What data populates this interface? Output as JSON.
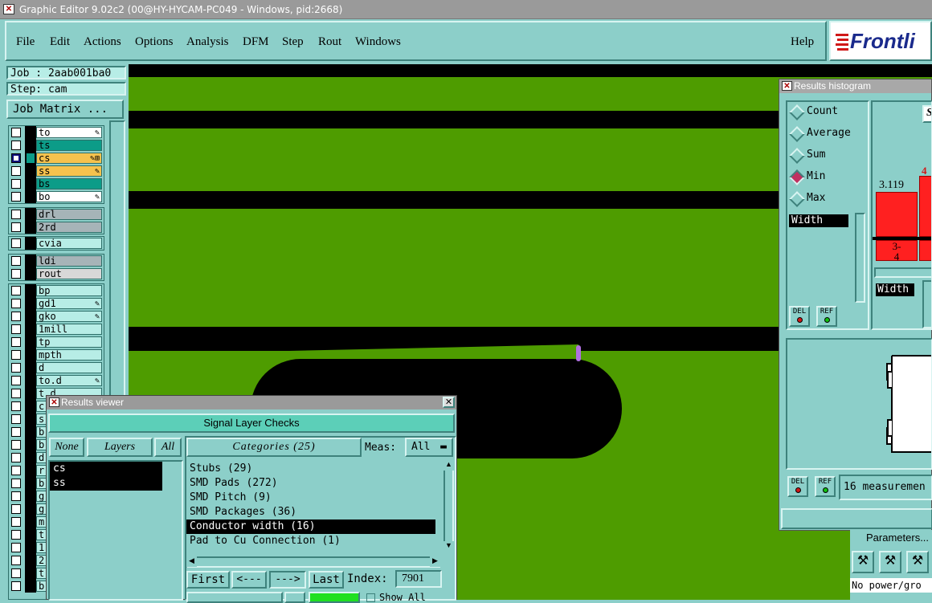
{
  "window": {
    "title": "Graphic Editor 9.02c2 (00@HY-HYCAM-PC049 - Windows, pid:2668)"
  },
  "menu": {
    "items": [
      "File",
      "Edit",
      "Actions",
      "Options",
      "Analysis",
      "DFM",
      "Step",
      "Rout",
      "Windows"
    ],
    "help": "Help"
  },
  "logo": {
    "text": "Frontli"
  },
  "left": {
    "job": "Job : 2aab001ba0",
    "step": "Step: cam",
    "job_matrix": "Job Matrix ...",
    "layers": {
      "g1": [
        "to",
        "ts",
        "cs",
        "ss",
        "bs",
        "bo"
      ],
      "g2": [
        "drl",
        "2rd"
      ],
      "g3": [
        "cvia"
      ],
      "g4": [
        "ldi",
        "rout"
      ],
      "g5": [
        "bp",
        "gd1",
        "gko",
        "1mill",
        "tp",
        "mpth",
        "d",
        "to.d",
        "t.d",
        "c",
        "s",
        "b",
        "b",
        "d",
        "r",
        "b",
        "g",
        "g",
        "m",
        "t",
        "1",
        "2",
        "t",
        "b"
      ]
    }
  },
  "results_viewer": {
    "title": "Results viewer",
    "header": "Signal Layer Checks",
    "none": "None",
    "layers_label": "Layers",
    "all": "All",
    "categories": "Categories (25)",
    "meas_label": "Meas:",
    "meas_value": "All",
    "layer_list": [
      "cs",
      "ss"
    ],
    "category_list": [
      "Stubs (29)",
      "SMD Pads (272)",
      "SMD Pitch (9)",
      "SMD Packages (36)",
      "Conductor width (16)",
      "Pad to Cu Connection (1)"
    ],
    "selected_category": "Conductor width (16)",
    "first": "First",
    "prev": "<---",
    "next": "--->",
    "last": "Last",
    "index_label": "Index:",
    "index_value": "7901",
    "show_all": "Show All"
  },
  "histogram": {
    "title": "Results histogram",
    "modes": [
      "Count",
      "Average",
      "Sum",
      "Min",
      "Max"
    ],
    "selected_mode": "Min",
    "metric": "Width",
    "metric2": "Width",
    "bar_value": "3.119",
    "bar_count": "4",
    "bin_label": "3-",
    "bin_label2": "4",
    "s_button": "S",
    "del": "DEL",
    "ref": "REF",
    "measurements": "16 measuremen",
    "bar_color": "#ff2020"
  },
  "parameters": {
    "label": "Parameters...",
    "status": "No power/gro"
  },
  "colors": {
    "canvas": "#4e9c00",
    "panel": "#8ccfc9",
    "accent": "#0c9c88"
  }
}
